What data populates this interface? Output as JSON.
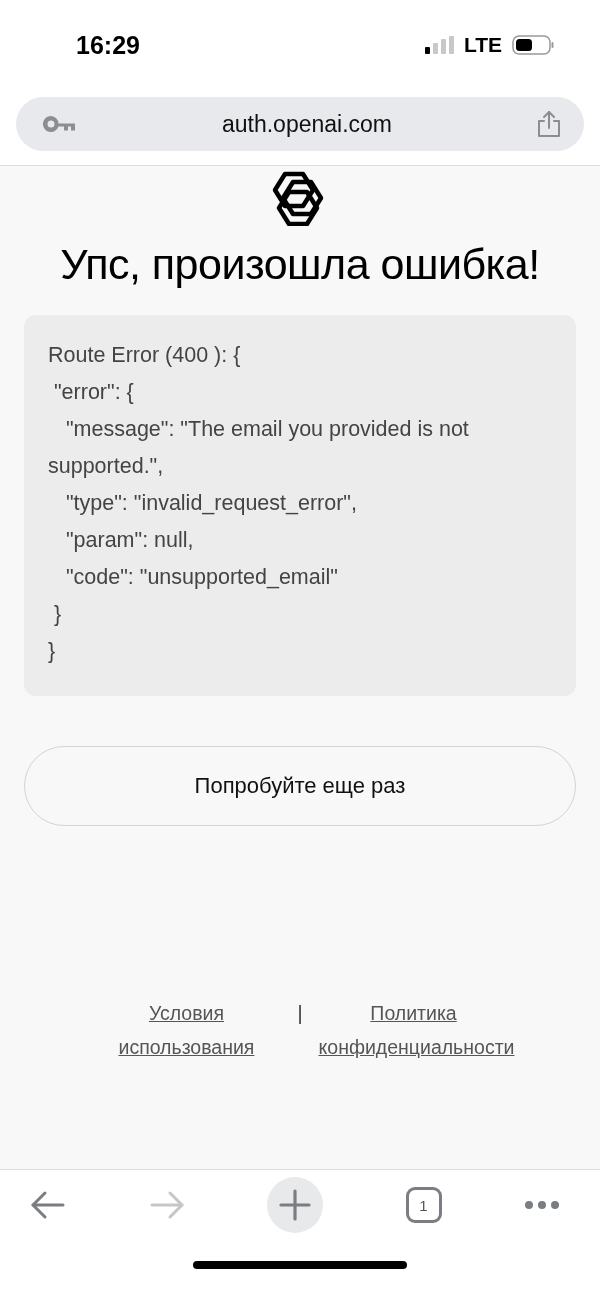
{
  "status_bar": {
    "time": "16:29",
    "network": "LTE"
  },
  "address_bar": {
    "url": "auth.openai.com"
  },
  "page": {
    "heading": "Упс, произошла ошибка!",
    "error_text": "Route Error (400 ): {\n \"error\": {\n   \"message\": \"The email you provided is not supported.\",\n   \"type\": \"invalid_request_error\",\n   \"param\": null,\n   \"code\": \"unsupported_email\"\n }\n}",
    "retry_button": "Попробуйте еще раз",
    "footer_links": [
      {
        "label": "Условия использования"
      },
      {
        "label": "Политика конфиденциальности"
      }
    ],
    "footer_separator": "|"
  },
  "toolbar": {
    "back": {
      "disabled": false
    },
    "forward": {
      "disabled": true
    },
    "tab_count": "1"
  }
}
